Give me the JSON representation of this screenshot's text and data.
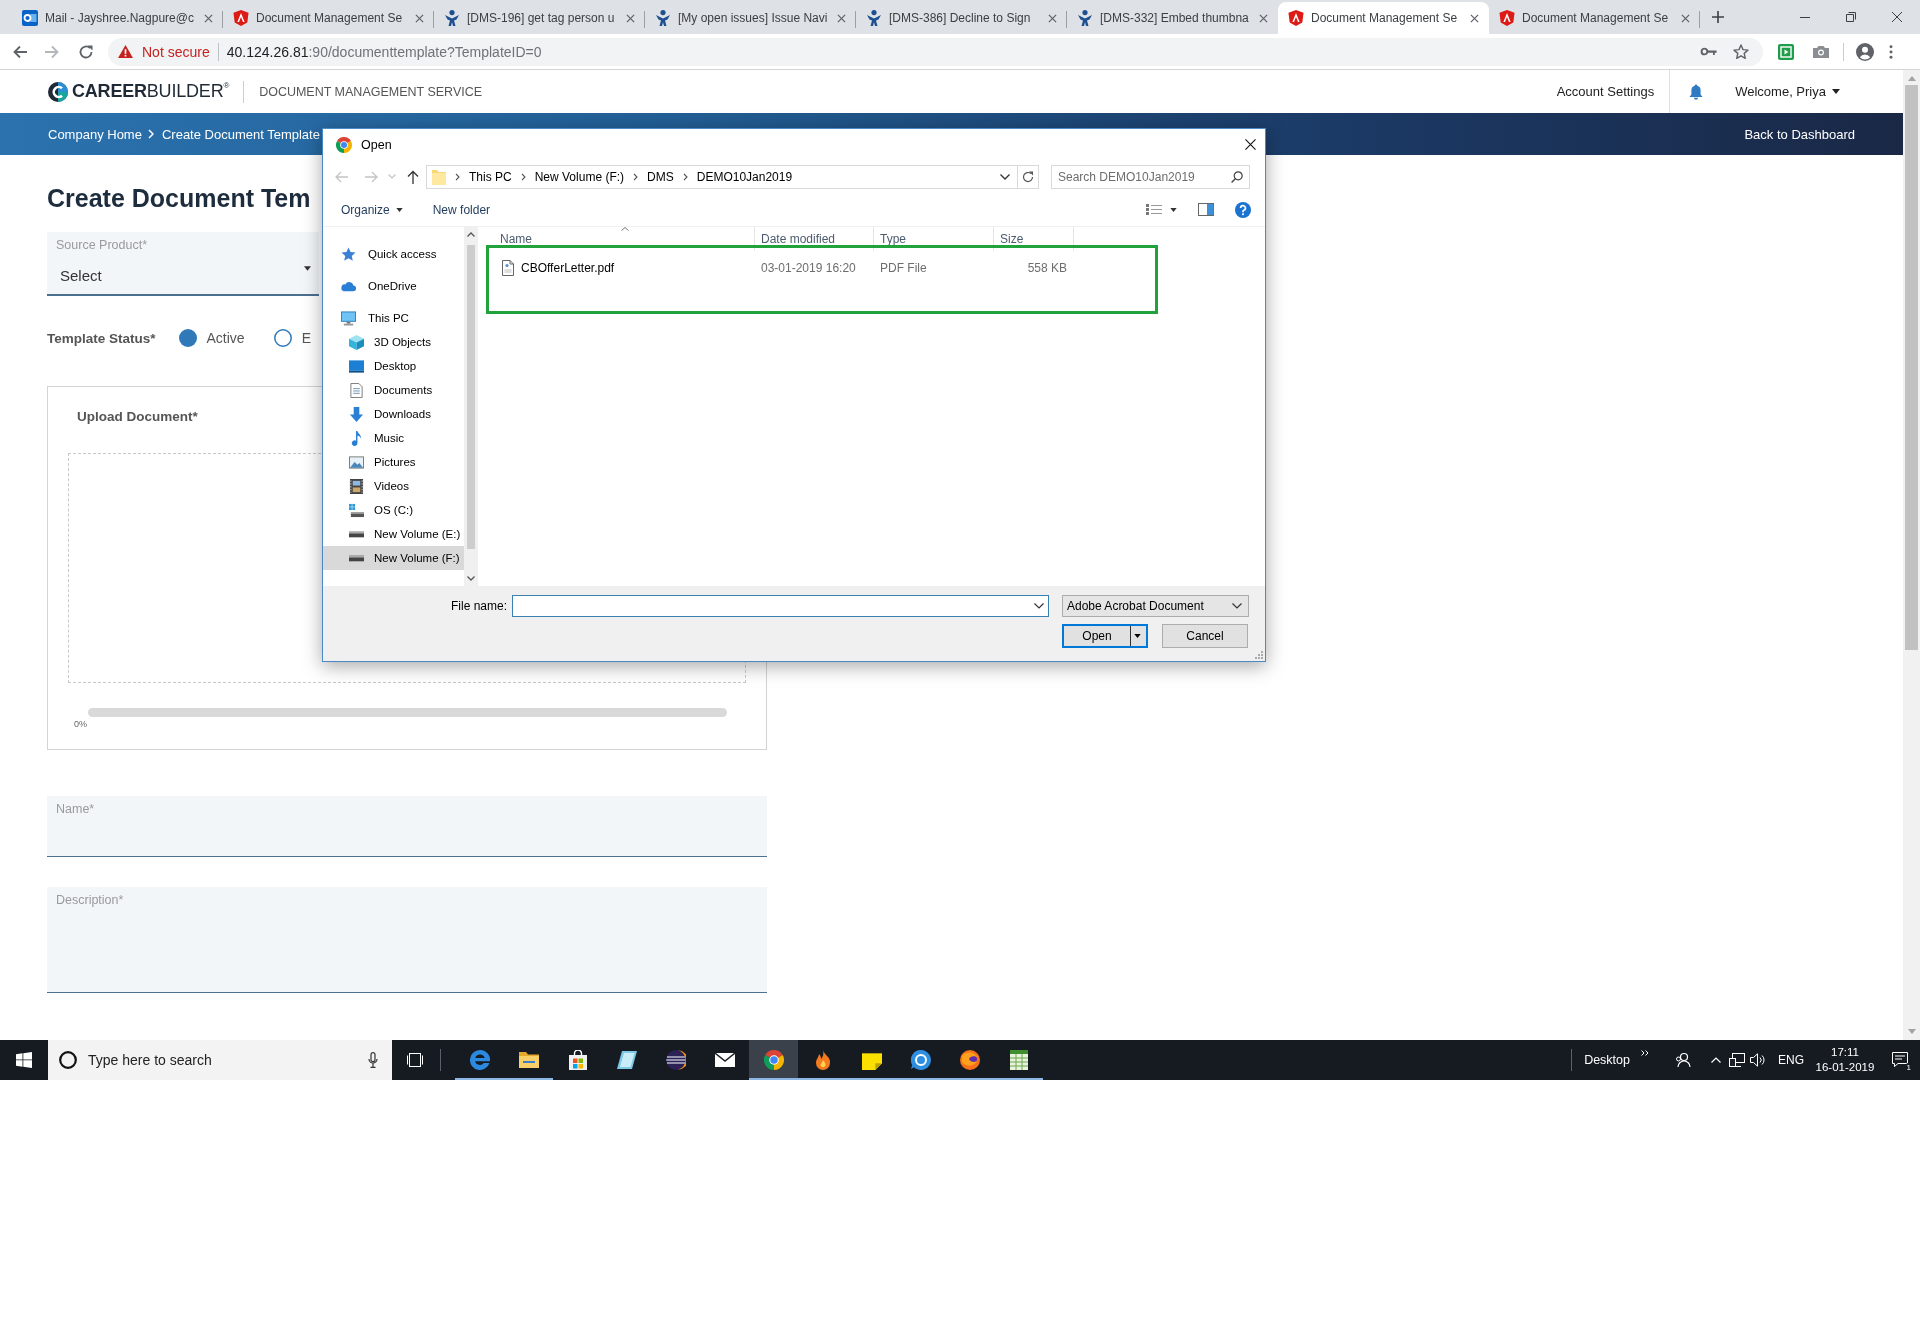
{
  "browser": {
    "tabs": [
      {
        "kind": "mail",
        "title": "Mail - Jayshree.Nagpure@c",
        "selected": false
      },
      {
        "kind": "app",
        "title": "Document Management Se",
        "selected": false
      },
      {
        "kind": "tracker",
        "title": "[DMS-196] get tag person u",
        "selected": false
      },
      {
        "kind": "tracker",
        "title": "[My open issues] Issue Navi",
        "selected": false
      },
      {
        "kind": "tracker",
        "title": "[DMS-386] Decline to Sign",
        "selected": false
      },
      {
        "kind": "tracker",
        "title": "[DMS-332] Embed thumbna",
        "selected": false
      },
      {
        "kind": "app",
        "title": "Document Management Se",
        "selected": true
      },
      {
        "kind": "app",
        "title": "Document Management Se",
        "selected": false
      }
    ],
    "security": "Not secure",
    "url_host": "40.124.26.81",
    "url_rest": ":90/documenttemplate?TemplateID=0"
  },
  "header": {
    "logo": "**CAREER**BUILDER$^{®}$",
    "service": "DOCUMENT MANAGEMENT SERVICE",
    "account_settings": "Account Settings",
    "welcome": "Welcome, Priya"
  },
  "navbar": {
    "breadcrumbs": [
      "Company Home",
      "Create Document Template"
    ],
    "back": "Back to Dashboard"
  },
  "form": {
    "title": "Create Document Tem",
    "source_product": {
      "label": "Source Product*",
      "value": "Select"
    },
    "template_status": {
      "label": "Template Status*",
      "options": [
        {
          "label": "Active",
          "selected": true
        },
        {
          "label": "E",
          "selected": false
        }
      ]
    },
    "upload": {
      "label": "Upload Document*",
      "level": 0,
      "reading": "0%"
    },
    "name": {
      "label": "Name*"
    },
    "description": {
      "label": "Description*"
    }
  },
  "dialog": {
    "title": "Open",
    "path": [
      "This PC",
      "New Volume (F:)",
      "DMS",
      "DEMO10Jan2019"
    ],
    "search": {
      "placeholder": "Search DEMO10Jan2019"
    },
    "toolbar": {
      "organize": "Organize",
      "new_folder": "New folder"
    },
    "nav": [
      {
        "kind": "star",
        "label": "Quick access",
        "selected": false
      },
      {
        "kind": "cloud",
        "label": "OneDrive",
        "selected": false
      },
      {
        "kind": "computer",
        "label": "This PC",
        "selected": false,
        "children": [
          {
            "kind": "cube",
            "label": "3D Objects",
            "selected": false
          },
          {
            "kind": "desktop",
            "label": "Desktop",
            "selected": false
          },
          {
            "kind": "document",
            "label": "Documents",
            "selected": false
          },
          {
            "kind": "download",
            "label": "Downloads",
            "selected": false
          },
          {
            "kind": "music",
            "label": "Music",
            "selected": false
          },
          {
            "kind": "picture",
            "label": "Pictures",
            "selected": false
          },
          {
            "kind": "video",
            "label": "Videos",
            "selected": false
          },
          {
            "kind": "system-drive",
            "label": "OS (C:)",
            "selected": false
          },
          {
            "kind": "drive",
            "label": "New Volume (E:)",
            "selected": false
          },
          {
            "kind": "drive",
            "label": "New Volume (F:)",
            "selected": true
          }
        ]
      }
    ],
    "columns": [
      "Name",
      "Date modified",
      "Type",
      "Size"
    ],
    "files": [
      {
        "name": "CBOfferLetter.pdf",
        "date": "03-01-2019 16:20",
        "type": "PDF File",
        "size": "558 KB",
        "highlighted": true
      }
    ],
    "file_name": {
      "label": "File name:"
    },
    "file_type": "Adobe Acrobat Document",
    "buttons": [
      {
        "kind": "split",
        "label": "Open"
      },
      {
        "kind": "plain",
        "label": "Cancel"
      }
    ]
  },
  "taskbar": {
    "search": {
      "placeholder": "Type here to search"
    },
    "apps": [
      {
        "kind": "swirl",
        "running": true,
        "selected": false
      },
      {
        "kind": "folder",
        "running": true,
        "selected": false
      },
      {
        "kind": "bag",
        "running": false,
        "selected": false
      },
      {
        "kind": "slate",
        "running": false,
        "selected": false
      },
      {
        "kind": "ring",
        "running": false,
        "selected": false
      },
      {
        "kind": "envelope",
        "running": false,
        "selected": false
      },
      {
        "kind": "tricolor",
        "running": true,
        "selected": true
      },
      {
        "kind": "flame",
        "running": true,
        "selected": false
      },
      {
        "kind": "note",
        "running": true,
        "selected": false
      },
      {
        "kind": "chat",
        "running": true,
        "selected": false
      },
      {
        "kind": "globe",
        "running": true,
        "selected": false
      },
      {
        "kind": "ledger",
        "running": true,
        "selected": false
      }
    ],
    "toolbar_label": "Desktop",
    "language": "ENG",
    "time": "17:11",
    "date": "16-01-2019",
    "notifications": "1"
  }
}
